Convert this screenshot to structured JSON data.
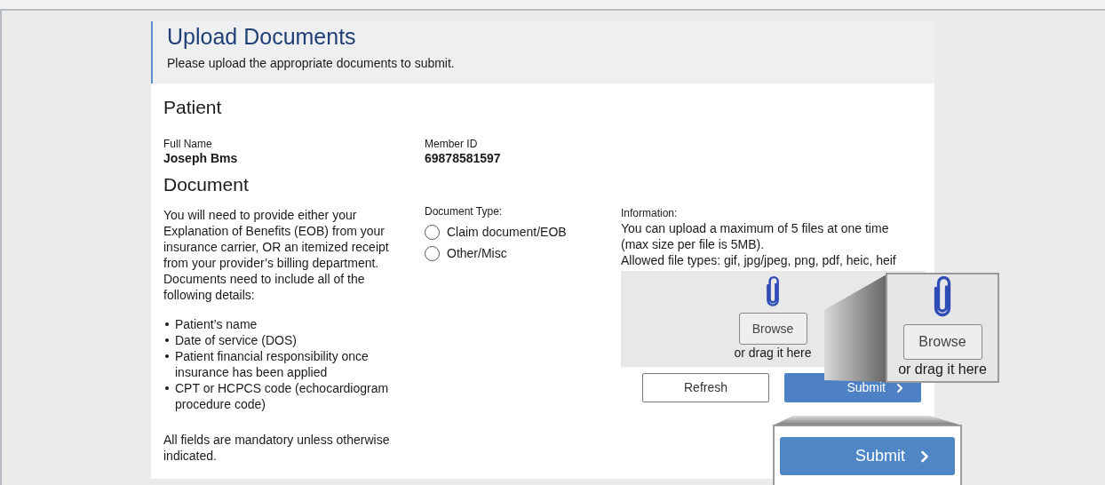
{
  "header": {
    "title": "Upload Documents",
    "subtitle": "Please upload the appropriate documents to submit."
  },
  "patient": {
    "heading": "Patient",
    "fields": [
      {
        "label": "Full Name",
        "value": "Joseph Bms"
      },
      {
        "label": "Member ID",
        "value": "69878581597"
      }
    ]
  },
  "document": {
    "heading": "Document",
    "intro": "You will need to provide either your Explanation of Benefits (EOB) from your insurance carrier, OR an itemized receipt from your provider’s billing department. Documents need to include all of the following details:",
    "bullets": [
      "Patient’s name",
      "Date of service (DOS)",
      "Patient financial responsibility once insurance has been applied",
      "CPT or HCPCS code (echocardiogram procedure code)"
    ],
    "note": "All fields are mandatory unless otherwise indicated.",
    "type_label": "Document Type:",
    "options": [
      {
        "label": "Claim document/EOB",
        "selected": false
      },
      {
        "label": "Other/Misc",
        "selected": false
      }
    ],
    "info_label": "Information:",
    "info_lines": [
      "You can upload a maximum of 5 files at one time",
      "(max size per file is 5MB).",
      "Allowed file types: gif, jpg/jpeg, png, pdf, heic, heif"
    ],
    "dropzone": {
      "browse": "Browse",
      "drag_text": "or drag it here"
    },
    "refresh": "Refresh",
    "submit": "Submit"
  },
  "callouts": {
    "browse_zoom": {
      "browse": "Browse",
      "drag_text": "or drag it here"
    },
    "submit_zoom": {
      "label": "Submit"
    }
  }
}
